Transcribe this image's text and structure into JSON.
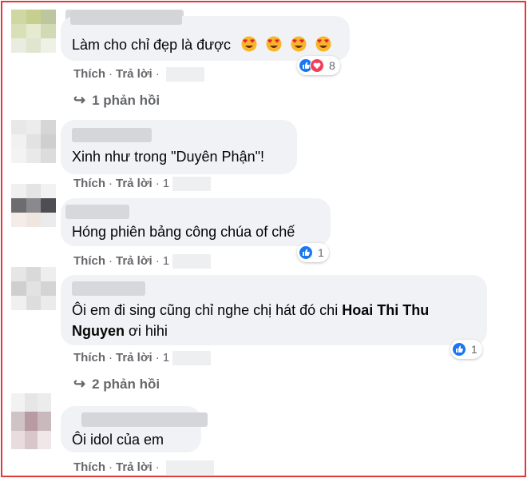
{
  "comments": [
    {
      "text": "Làm cho chỉ đẹp là được",
      "emojis": [
        "heart-eyes",
        "heart-eyes",
        "heart-eyes",
        "heart-eyes"
      ],
      "reaction_count": "8",
      "reaction_icons": [
        "like-icon",
        "love-icon"
      ],
      "like_label": "Thích",
      "reply_label": "Trả lời",
      "replies_label": "1 phản hồi"
    },
    {
      "text": "Xinh như trong \"Duyên Phận\"!",
      "like_label": "Thích",
      "reply_label": "Trả lời",
      "time_partial": "1"
    },
    {
      "text": "Hóng phiên bảng công chúa of chế",
      "reaction_count": "1",
      "reaction_icons": [
        "like-icon"
      ],
      "like_label": "Thích",
      "reply_label": "Trả lời",
      "time_partial": "1"
    },
    {
      "text_line1": "Ôi em đi sing cũng chỉ nghe chị hát đó chi",
      "mention": "Hoai Thi Thu",
      "mention_line2": "Nguyen",
      "text_line2_rest": "ơi hihi",
      "reaction_count": "1",
      "reaction_icons": [
        "like-icon"
      ],
      "like_label": "Thích",
      "reply_label": "Trả lời",
      "time_partial": "1",
      "replies_label": "2 phản hồi"
    },
    {
      "text": "Ôi idol của em",
      "like_label": "Thích",
      "reply_label": "Trả lời"
    }
  ],
  "colors": {
    "bubble": "#f0f2f5",
    "muted": "#65676b",
    "like_blue": "#1877f2",
    "love_red": "#f33e58",
    "frame": "#e0393a"
  }
}
